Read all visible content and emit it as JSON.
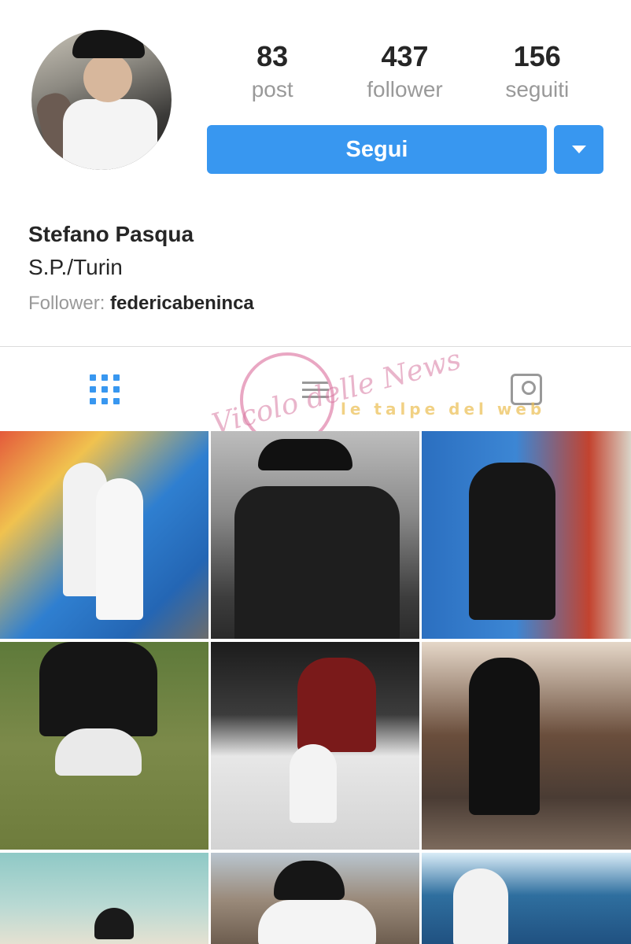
{
  "profile": {
    "name": "Stefano Pasqua",
    "location": "S.P./Turin",
    "followed_by_label": "Follower:",
    "followed_by_user": "federicabeninca"
  },
  "stats": [
    {
      "value": "83",
      "label": "post"
    },
    {
      "value": "437",
      "label": "follower"
    },
    {
      "value": "156",
      "label": "seguiti"
    }
  ],
  "actions": {
    "follow_label": "Segui",
    "more_icon": "triangle-down-icon"
  },
  "tabs": [
    {
      "name": "grid",
      "icon": "grid-icon",
      "active": true
    },
    {
      "name": "list",
      "icon": "list-icon",
      "active": false
    },
    {
      "name": "tagged",
      "icon": "tagged-icon",
      "active": false
    }
  ],
  "watermark": {
    "text1": "Vicolo delle News",
    "text2": "le talpe del web"
  },
  "colors": {
    "accent": "#3897f0",
    "text": "#262626",
    "muted": "#999999",
    "divider": "#dbdbdb"
  }
}
